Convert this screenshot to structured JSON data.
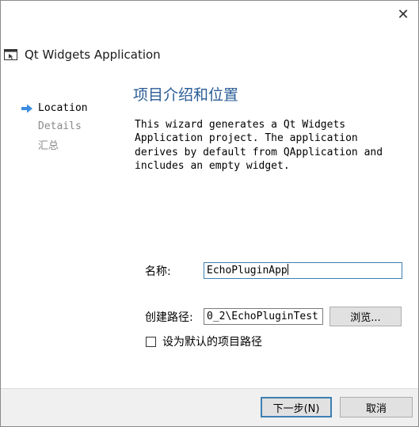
{
  "window": {
    "title": "Qt Widgets Application",
    "close_symbol": "✕",
    "icon": "qt-app-window-icon"
  },
  "steps": {
    "current_icon": "right-arrow-icon",
    "items": [
      {
        "label": "Location",
        "state": "current"
      },
      {
        "label": "Details",
        "state": "pending"
      },
      {
        "label": "汇总",
        "state": "pending"
      }
    ]
  },
  "page": {
    "title": "项目介绍和位置",
    "description": "This wizard generates a Qt Widgets\nApplication project. The application\nderives by default from QApplication and\nincludes an empty widget."
  },
  "form": {
    "name_label": "名称:",
    "name_value": "EchoPluginApp",
    "path_label": "创建路径:",
    "path_value": "0_2\\EchoPluginTest",
    "browse_label": "浏览...",
    "default_path_label": "设为默认的项目路径",
    "default_path_checked": false
  },
  "footer": {
    "next_label": "下一步(N)",
    "cancel_label": "取消"
  },
  "colors": {
    "accent": "#2a5d96",
    "arrow": "#3c8ce0",
    "focus_border": "#3c7fb1"
  }
}
